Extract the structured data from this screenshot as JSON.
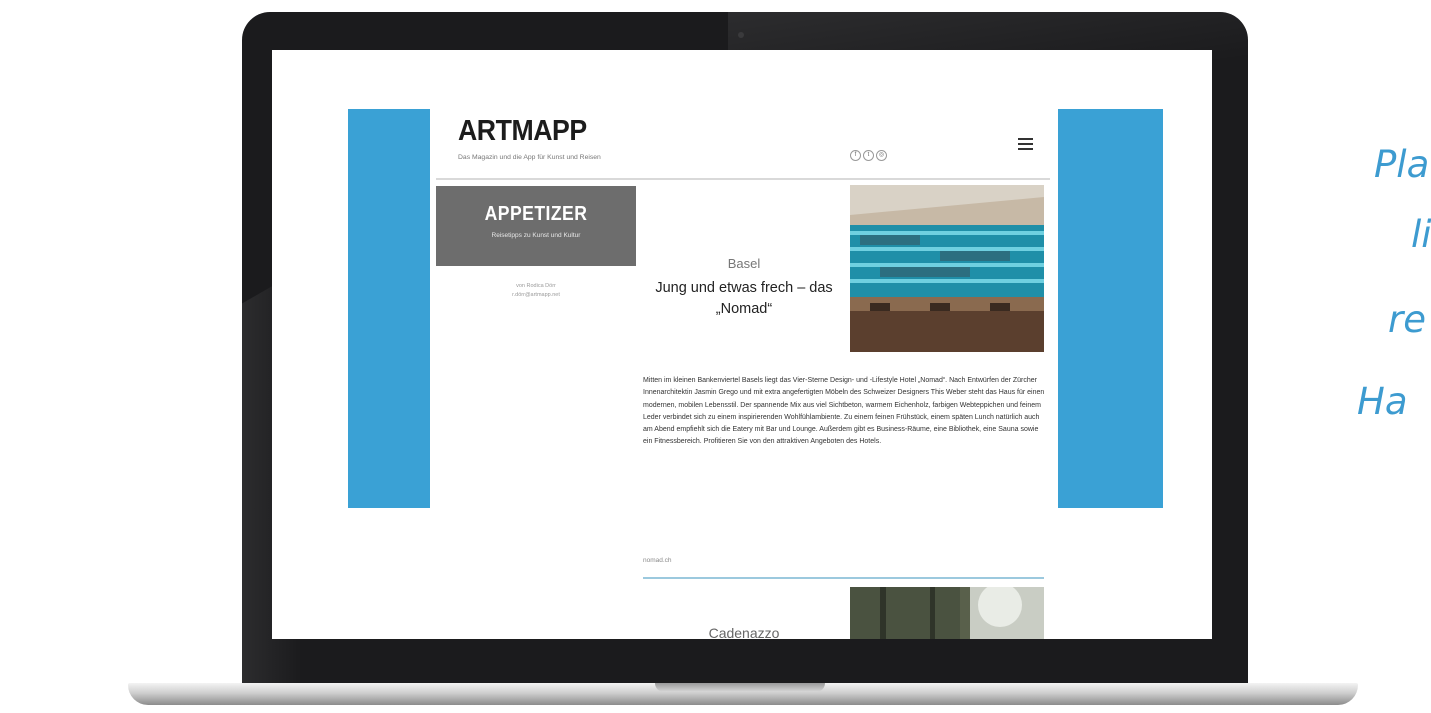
{
  "site": {
    "logo": "ARTMAPP",
    "tagline": "Das Magazin und die App für Kunst und Reisen",
    "social_icons": [
      "facebook-icon",
      "twitter-icon",
      "instagram-icon"
    ],
    "social_glyphs": [
      "f",
      "t",
      "◎"
    ]
  },
  "sidebar": {
    "section_title": "APPETIZER",
    "section_subtitle": "Reisetipps zu Kunst und Kultur",
    "author_line1": "von Rodica Dörr",
    "author_line2": "r.dörr@artmapp.net"
  },
  "article": {
    "city": "Basel",
    "headline": "Jung und etwas frech – das „Nomad“",
    "body": "Mitten im kleinen Bankenviertel Basels liegt das Vier-Sterne Design- und -Lifestyle Hotel „Nomad“. Nach Entwürfen der Zürcher Innenarchitektin Jasmin Grego und mit extra angefertigten Möbeln des Schweizer Designers This Weber steht das Haus für einen modernen, mobilen Lebensstil. Der spannende Mix aus viel Sichtbeton, warmem Eichenholz, farbigen Webteppichen und feinem Leder verbindet sich zu einem inspirierenden Wohlfühlambiente. Zu einem feinen Frühstück, einem späten Lunch natürlich auch am Abend empfiehlt sich die Eatery mit Bar und Lounge. Außerdem gibt es Business-Räume, eine Bibliothek, eine Sauna sowie ein Fitnessbereich. Profitieren Sie von den attraktiven Angeboten des Hotels.",
    "source": "nomad.ch",
    "next_title": "Cadenazzo"
  },
  "promo": {
    "line1": "Pla",
    "line2": "li",
    "line3": "re",
    "line4": "Ha"
  },
  "colors": {
    "accent_blue": "#3aa1d5",
    "appetizer_bg": "#6d6d6d",
    "promo_text": "#3d9bd0"
  }
}
